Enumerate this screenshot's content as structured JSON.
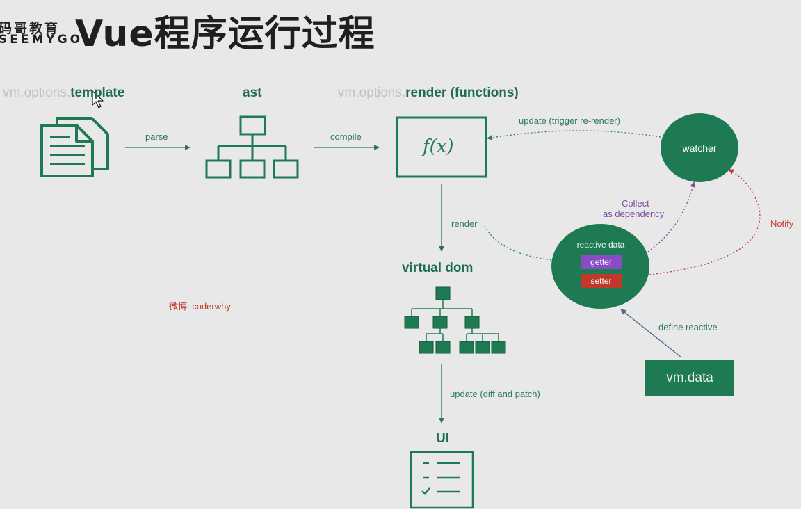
{
  "header": {
    "logo_line1": "码哥教育",
    "logo_line2": "SEEMYGO",
    "title": "Vue程序运行过程"
  },
  "labels": {
    "template_prefix": "vm.options.",
    "template_main": "template",
    "ast": "ast",
    "render_prefix": "vm.options.",
    "render_main": "render (functions)",
    "virtual_dom": "virtual dom",
    "ui": "UI",
    "fx": "f(x)"
  },
  "edges": {
    "parse": "parse",
    "compile": "compile",
    "update_trigger": "update (trigger re-render)",
    "render": "render",
    "update_diff": "update (diff and patch)",
    "collect_1": "Collect",
    "collect_2": "as dependency",
    "notify": "Notify",
    "define_reactive": "define reactive"
  },
  "nodes": {
    "watcher": "watcher",
    "reactive_data": "reactive data",
    "getter": "getter",
    "setter": "setter",
    "vm_data": "vm.data"
  },
  "watermark": "微博: coderwhy",
  "colors": {
    "background": "#e8e8e8",
    "accent_green": "#1e7a52",
    "getter_purple": "#8a4cc2",
    "setter_red": "#c0392b"
  }
}
